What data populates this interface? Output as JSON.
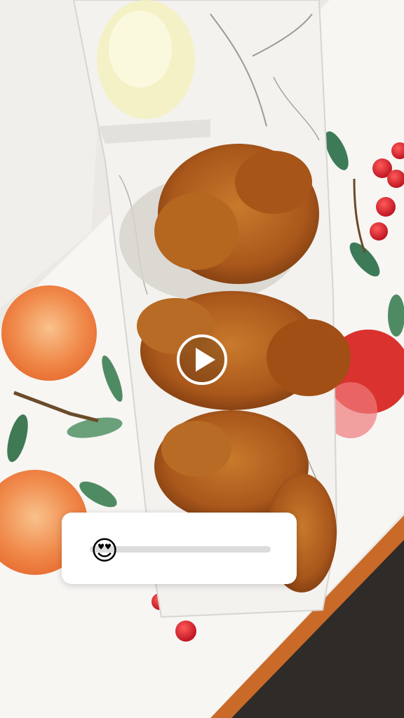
{
  "media": {
    "subject": "fried-chicken-photo",
    "play_icon": "play-icon"
  },
  "slider": {
    "emoji": "😍",
    "value": 0.0,
    "track_color": "#dcdcdc"
  },
  "colors": {
    "card_bg": "#ffffff",
    "chicken": "#b3641f",
    "tray": "#f2f1ee",
    "peach": "#f08a4b"
  }
}
